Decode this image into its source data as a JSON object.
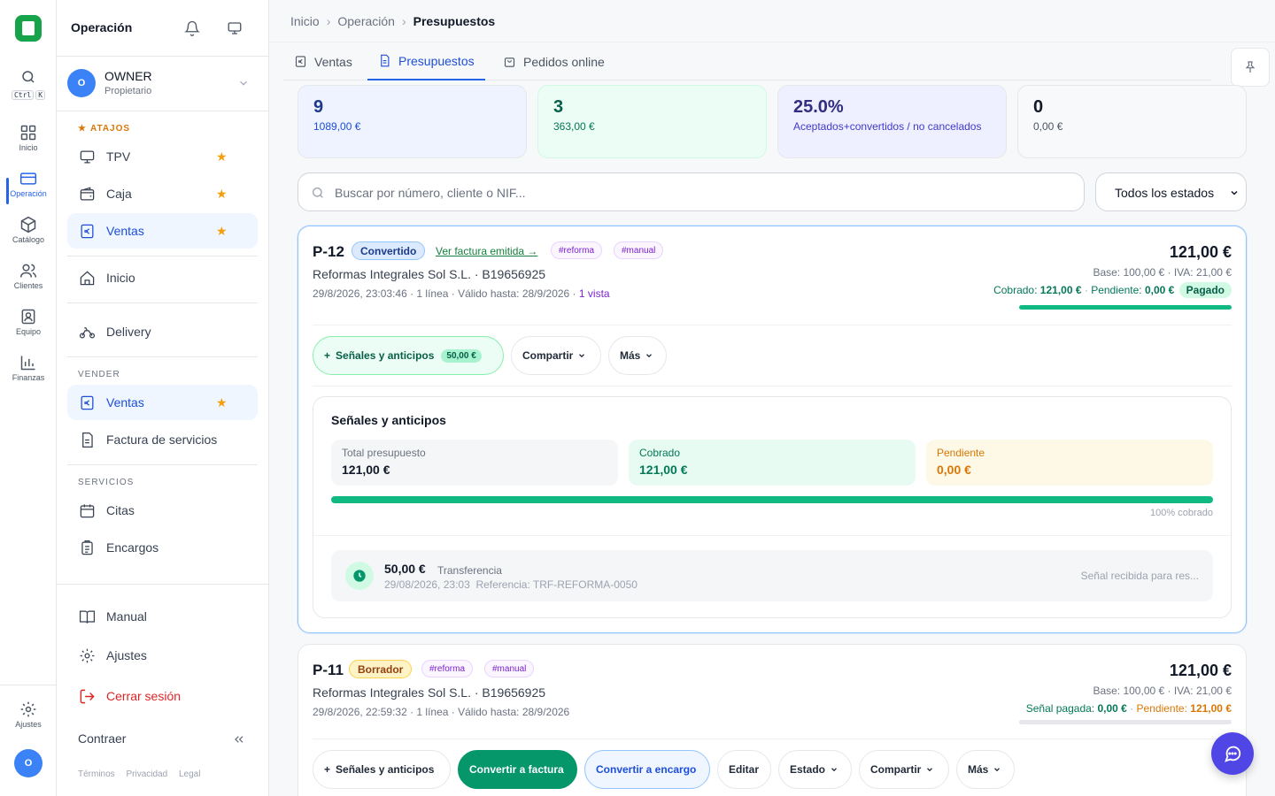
{
  "rail": {
    "kbd": [
      "Ctrl",
      "K"
    ],
    "items": [
      {
        "label": "Inicio",
        "icon": "grid-icon"
      },
      {
        "label": "Operación",
        "icon": "card-icon",
        "active": true
      },
      {
        "label": "Catálogo",
        "icon": "box-icon"
      },
      {
        "label": "Clientes",
        "icon": "users-icon"
      },
      {
        "label": "Equipo",
        "icon": "badge-icon"
      },
      {
        "label": "Finanzas",
        "icon": "chart-icon"
      }
    ],
    "settings_label": "Ajustes",
    "avatar_initial": "O"
  },
  "sidebar": {
    "title": "Operación",
    "user": {
      "initial": "O",
      "name": "OWNER",
      "role": "Propietario"
    },
    "favorites_label": "ATAJOS",
    "favorites": [
      {
        "label": "TPV",
        "icon": "monitor-icon"
      },
      {
        "label": "Caja",
        "icon": "wallet-icon"
      },
      {
        "label": "Ventas",
        "icon": "euro-icon",
        "active": true
      }
    ],
    "inicio": "Inicio",
    "delivery": "Delivery",
    "vender_label": "VENDER",
    "vender": [
      {
        "label": "Ventas",
        "icon": "euro-icon",
        "active": true
      },
      {
        "label": "Factura de servicios",
        "icon": "invoice-icon"
      }
    ],
    "servicios_label": "SERVICIOS",
    "servicios": [
      {
        "label": "Citas",
        "icon": "calendar-icon"
      },
      {
        "label": "Encargos",
        "icon": "clipboard-icon"
      }
    ],
    "manual": "Manual",
    "ajustes": "Ajustes",
    "logout": "Cerrar sesión",
    "collapse": "Contraer",
    "footer": [
      "Términos",
      "Privacidad",
      "Legal"
    ]
  },
  "breadcrumb": [
    "Inicio",
    "Operación",
    "Presupuestos"
  ],
  "tabs": [
    "Ventas",
    "Presupuestos",
    "Pedidos online"
  ],
  "stats": [
    {
      "value": "9",
      "sub": "1089,00 €"
    },
    {
      "value": "3",
      "sub": "363,00 €"
    },
    {
      "value": "25.0%",
      "sub": "Aceptados+convertidos / no cancelados"
    },
    {
      "value": "0",
      "sub": "0,00 €"
    }
  ],
  "search": {
    "placeholder": "Buscar por número, cliente o NIF..."
  },
  "filter": {
    "value": "Todos los estados"
  },
  "quotes": [
    {
      "id": "P-12",
      "status": "Convertido",
      "invoice_link": "Ver factura emitida →",
      "tags": [
        "#reforma",
        "#manual"
      ],
      "customer": "Reformas Integrales Sol S.L. · B19656925",
      "meta": "29/8/2026, 23:03:46 · 1 línea · Válido hasta: 28/9/2026 ·",
      "views": "1 vista",
      "total": "121,00 €",
      "base": "Base: 100,00 € · IVA: 21,00 €",
      "collected_label": "Cobrado:",
      "collected": "121,00 €",
      "pending_label": "Pendiente:",
      "pending": "0,00 €",
      "paid_badge": "Pagado",
      "progress": 1.0,
      "actions": {
        "deposits": "Señales y anticipos",
        "deposits_amount": "50,00 €",
        "share": "Compartir",
        "more": "Más"
      },
      "panel": {
        "title": "Señales y anticipos",
        "total_label": "Total presupuesto",
        "total": "121,00 €",
        "collected_label": "Cobrado",
        "collected": "121,00 €",
        "pending_label": "Pendiente",
        "pending": "0,00 €",
        "pct": "100% cobrado",
        "payment": {
          "amount": "50,00 €",
          "method": "Transferencia",
          "date": "29/08/2026, 23:03",
          "ref": "Referencia: TRF-REFORMA-0050",
          "note": "Señal recibida para res..."
        }
      }
    },
    {
      "id": "P-11",
      "status": "Borrador",
      "tags": [
        "#reforma",
        "#manual"
      ],
      "customer": "Reformas Integrales Sol S.L. · B19656925",
      "meta": "29/8/2026, 22:59:32 · 1 línea · Válido hasta: 28/9/2026",
      "total": "121,00 €",
      "base": "Base: 100,00 € · IVA: 21,00 €",
      "deposit_label": "Señal pagada:",
      "deposit": "0,00 €",
      "pending_label": "Pendiente:",
      "pending": "121,00 €",
      "progress": 0.0,
      "actions": {
        "deposits": "Señales y anticipos",
        "to_invoice": "Convertir a factura",
        "to_order": "Convertir a encargo",
        "edit": "Editar",
        "status": "Estado",
        "share": "Compartir",
        "more": "Más"
      }
    }
  ],
  "colors": {
    "accent": "#2563eb",
    "success": "#059669",
    "warning": "#d97706",
    "danger": "#dc2626",
    "chat": "#4f46e5"
  }
}
